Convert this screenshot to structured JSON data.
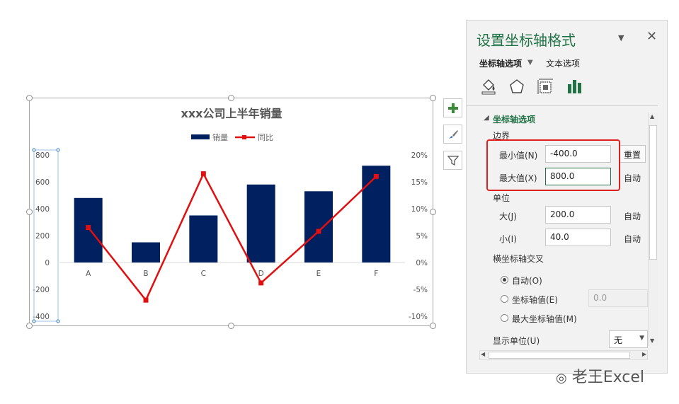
{
  "chart_data": {
    "type": "bar",
    "title": "xxx公司上半年销量",
    "categories": [
      "A",
      "B",
      "C",
      "D",
      "E",
      "F"
    ],
    "series": [
      {
        "name": "销量",
        "type": "bar",
        "axis": "primary",
        "color": "#002060",
        "values": [
          480,
          150,
          350,
          580,
          530,
          720
        ]
      },
      {
        "name": "同比",
        "type": "line",
        "axis": "secondary",
        "color": "#e01010",
        "values": [
          6.5,
          -7.0,
          16.5,
          -3.8,
          5.8,
          16.0
        ]
      }
    ],
    "y_primary": {
      "min": -400,
      "max": 800,
      "ticks": [
        "800",
        "600",
        "400",
        "200",
        "0",
        "-200",
        "-400"
      ],
      "tick_values": [
        800,
        600,
        400,
        200,
        0,
        -200,
        -400
      ]
    },
    "y_secondary": {
      "min": -10,
      "max": 20,
      "ticks": [
        "20%",
        "15%",
        "10%",
        "5%",
        "0%",
        "-5%",
        "-10%"
      ],
      "tick_values": [
        20,
        15,
        10,
        5,
        0,
        -5,
        -10
      ]
    },
    "legend": "top"
  },
  "side_buttons": [
    "plus-icon",
    "brush-icon",
    "filter-icon"
  ],
  "pane": {
    "title": "设置坐标轴格式",
    "tabs": {
      "axis": "坐标轴选项",
      "text": "文本选项"
    },
    "section": "坐标轴选项",
    "bounds_label": "边界",
    "min_label": "最小值(N)",
    "min_value": "-400.0",
    "min_button": "重置",
    "max_label": "最大值(X)",
    "max_value": "800.0",
    "max_button": "自动",
    "units_label": "单位",
    "major_label": "大(J)",
    "major_value": "200.0",
    "major_button": "自动",
    "minor_label": "小(I)",
    "minor_value": "40.0",
    "minor_button": "自动",
    "cross_label": "横坐标轴交叉",
    "cross_auto": "自动(O)",
    "cross_value_label": "坐标轴值(E)",
    "cross_value": "0.0",
    "cross_max": "最大坐标轴值(M)",
    "display_units_label": "显示单位(U)",
    "display_units_value": "无"
  },
  "watermark": "老王Excel"
}
